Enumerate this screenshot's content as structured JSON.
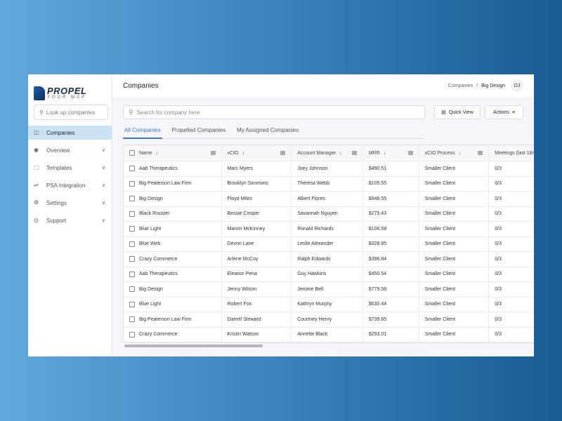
{
  "sidebar": {
    "logo_top": "PROPEL",
    "logo_bottom": "YOUR MSP",
    "search_placeholder": "Look up companies",
    "items": [
      {
        "label": "Companies",
        "icon": "database-icon",
        "active": true
      },
      {
        "label": "Overview",
        "icon": "eye-icon"
      },
      {
        "label": "Templates",
        "icon": "folder-icon"
      },
      {
        "label": "PSA Integration",
        "icon": "sliders-icon"
      },
      {
        "label": "Settings",
        "icon": "gear-icon"
      },
      {
        "label": "Support",
        "icon": "lifebuoy-icon"
      }
    ]
  },
  "header": {
    "title": "Companies",
    "breadcrumb": [
      "Companies",
      "Big Design"
    ],
    "avatar": "DJ"
  },
  "toolbar": {
    "search_placeholder": "Search for company here",
    "quick_view": "Quick View",
    "actions": "Actions"
  },
  "tabs": [
    "All Companies",
    "Propelled Companies",
    "My Assigned Companies"
  ],
  "table": {
    "columns": [
      "Name",
      "vCIO",
      "Account Manager",
      "MRR",
      "vCIO Process",
      "Meetings (last 18m"
    ],
    "rows": [
      [
        "Aab Therapeutics",
        "Marc Myers",
        "Joey Johnson",
        "$490.51",
        "Smaller Client",
        "0/3"
      ],
      [
        "Big Peaterson Law Firm",
        "Brooklyn Simmons",
        "Theresa Webb",
        "$105.55",
        "Smaller Client",
        "0/3"
      ],
      [
        "Big Design",
        "Floyd Miles",
        "Albert Flores",
        "$948.55",
        "Smaller Client",
        "0/3"
      ],
      [
        "Black Rooster",
        "Bessie Cooper",
        "Savannah Nguyen",
        "$275.43",
        "Smaller Client",
        "0/3"
      ],
      [
        "Blue Light",
        "Marvin McKinney",
        "Ronald Richards",
        "$106.58",
        "Smaller Client",
        "0/3"
      ],
      [
        "Blue Web",
        "Devon Lane",
        "Leslie Alexander",
        "$328.85",
        "Smaller Client",
        "0/3"
      ],
      [
        "Crazy Commerce",
        "Arlene McCoy",
        "Ralph Edwards",
        "$396.84",
        "Smaller Client",
        "0/3"
      ],
      [
        "Aab Therapeutics",
        "Eleanor Pena",
        "Guy Hawkins",
        "$450.54",
        "Smaller Client",
        "0/3"
      ],
      [
        "Big Design",
        "Jenny Wilson",
        "Jerome Bell",
        "$779.58",
        "Smaller Client",
        "0/3"
      ],
      [
        "Blue Light",
        "Robert Fox",
        "Kathryn Murphy",
        "$630.44",
        "Smaller Client",
        "0/3"
      ],
      [
        "Big Peaterson Law Firm",
        "Darrell Steward",
        "Courtney Henry",
        "$739.65",
        "Smaller Client",
        "0/3"
      ],
      [
        "Crazy Commerce",
        "Kristin Watson",
        "Annette Black",
        "$293.01",
        "Smaller Client",
        "0/3"
      ]
    ]
  }
}
